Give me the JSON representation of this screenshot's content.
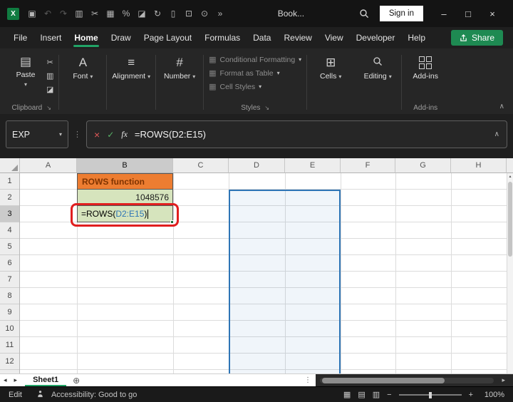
{
  "titlebar": {
    "title": "Book...",
    "sign_in": "Sign in"
  },
  "menubar": {
    "items": [
      "File",
      "Insert",
      "Home",
      "Draw",
      "Page Layout",
      "Formulas",
      "Data",
      "Review",
      "View",
      "Developer",
      "Help"
    ],
    "active": "Home",
    "share": "Share"
  },
  "ribbon": {
    "paste": "Paste",
    "font": "Font",
    "alignment": "Alignment",
    "number": "Number",
    "conditional_formatting": "Conditional Formatting",
    "format_as_table": "Format as Table",
    "cell_styles": "Cell Styles",
    "cells": "Cells",
    "editing": "Editing",
    "add_ins": "Add-ins",
    "groups": {
      "clipboard": "Clipboard",
      "styles": "Styles",
      "add_ins": "Add-ins"
    }
  },
  "formula_bar": {
    "name_box": "EXP",
    "fx": "fx",
    "formula": "=ROWS(D2:E15)"
  },
  "grid": {
    "columns": [
      "A",
      "B",
      "C",
      "D",
      "E",
      "F",
      "G",
      "H"
    ],
    "rows": [
      "1",
      "2",
      "3",
      "4",
      "5",
      "6",
      "7",
      "8",
      "9",
      "10",
      "11",
      "12"
    ],
    "cells": {
      "b1": "ROWS function",
      "b2": "1048576",
      "b3_prefix": "=ROWS(",
      "b3_ref": "D2:E15",
      "b3_suffix": ")"
    }
  },
  "sheet_tabs": {
    "active_tab": "Sheet1"
  },
  "status_bar": {
    "mode": "Edit",
    "accessibility": "Accessibility: Good to go",
    "zoom": "100%"
  },
  "colors": {
    "accent_green": "#21a366",
    "share_green": "#1e8a52",
    "selection_blue": "#2e75b6",
    "annotation_red": "#e01e1e",
    "b1_fill": "#ed7d31",
    "b1_text": "#7f3300",
    "b_green_fill": "#d6e4bd"
  },
  "icons": {
    "app": "X",
    "save": "▣",
    "undo": "↶",
    "redo": "↷",
    "book": "▥",
    "cut": "✂",
    "picture": "▦",
    "percent": "%",
    "paint": "◪",
    "history": "↻",
    "document": "▯",
    "stamp": "⊡",
    "camera": "⊙",
    "overflow": "»",
    "chevron_down": "▾",
    "chevron_up": "∧",
    "cancel": "×",
    "check": "✓",
    "dots": "⋮",
    "clipboard": "▤",
    "font": "A",
    "alignment": "≡",
    "number": "#",
    "styles": "▦",
    "cells": "⊞",
    "add_sheet": "⊕",
    "nav_left": "◂",
    "nav_right": "▸",
    "minimize": "–",
    "maximize": "□",
    "close": "×",
    "zoom_out": "−",
    "zoom_in": "+",
    "view_normal": "▦",
    "view_layout": "▤",
    "view_break": "▥",
    "launcher": "↘",
    "scroll_up": "▴"
  }
}
